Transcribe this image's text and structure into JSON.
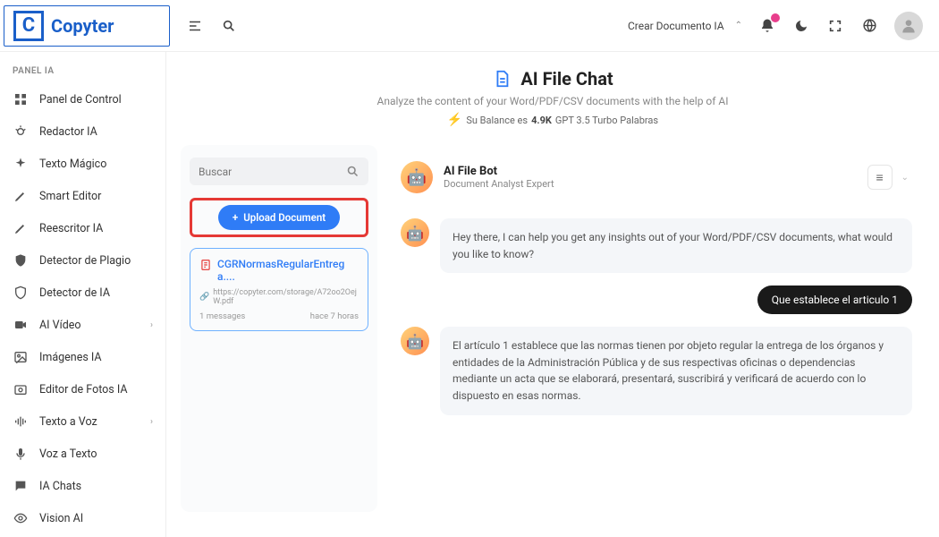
{
  "brand": "Copyter",
  "logo_letter": "C",
  "topbar": {
    "create_doc_label": "Crear Documento IA"
  },
  "sidebar": {
    "section_label": "PANEL IA",
    "items": [
      {
        "label": "Panel de Control",
        "chev": false,
        "icon": "grid"
      },
      {
        "label": "Redactor IA",
        "chev": false,
        "icon": "bug"
      },
      {
        "label": "Texto Mágico",
        "chev": false,
        "icon": "sparkle"
      },
      {
        "label": "Smart Editor",
        "chev": false,
        "icon": "pen"
      },
      {
        "label": "Reescritor IA",
        "chev": false,
        "icon": "pen"
      },
      {
        "label": "Detector de Plagio",
        "chev": false,
        "icon": "shield"
      },
      {
        "label": "Detector de IA",
        "chev": false,
        "icon": "shield2"
      },
      {
        "label": "AI Vídeo",
        "chev": true,
        "icon": "video"
      },
      {
        "label": "Imágenes IA",
        "chev": false,
        "icon": "image"
      },
      {
        "label": "Editor de Fotos IA",
        "chev": false,
        "icon": "photo"
      },
      {
        "label": "Texto a Voz",
        "chev": true,
        "icon": "sound"
      },
      {
        "label": "Voz a Texto",
        "chev": false,
        "icon": "mic"
      },
      {
        "label": "IA Chats",
        "chev": false,
        "icon": "chat"
      },
      {
        "label": "Vision AI",
        "chev": false,
        "icon": "eye"
      }
    ]
  },
  "page": {
    "title": "AI File Chat",
    "subtitle": "Analyze the content of your Word/PDF/CSV documents with the help of AI",
    "balance_prefix": "Su Balance es ",
    "balance_value": "4.9K",
    "balance_suffix": " GPT 3.5 Turbo Palabras"
  },
  "search": {
    "placeholder": "Buscar"
  },
  "upload": {
    "label": "Upload Document"
  },
  "document": {
    "name": "CGRNormasRegularEntrega....",
    "url": "https://copyter.com/storage/A72oo2OejW.pdf",
    "messages_count": "1 messages",
    "time": "hace 7 horas"
  },
  "bot": {
    "name": "AI File Bot",
    "role": "Document Analyst Expert"
  },
  "chat": [
    {
      "from": "bot",
      "text": "Hey there, I can help you get any insights out of your Word/PDF/CSV documents, what would you like to know?"
    },
    {
      "from": "user",
      "text": "Que establece el articulo 1"
    },
    {
      "from": "bot",
      "text": "El artículo 1 establece que las normas tienen por objeto regular la entrega de los órganos y entidades de la Administración Pública y de sus respectivas oficinas o dependencias mediante un acta que se elaborará, presentará, suscribirá y verificará de acuerdo con lo dispuesto en esas normas."
    }
  ]
}
